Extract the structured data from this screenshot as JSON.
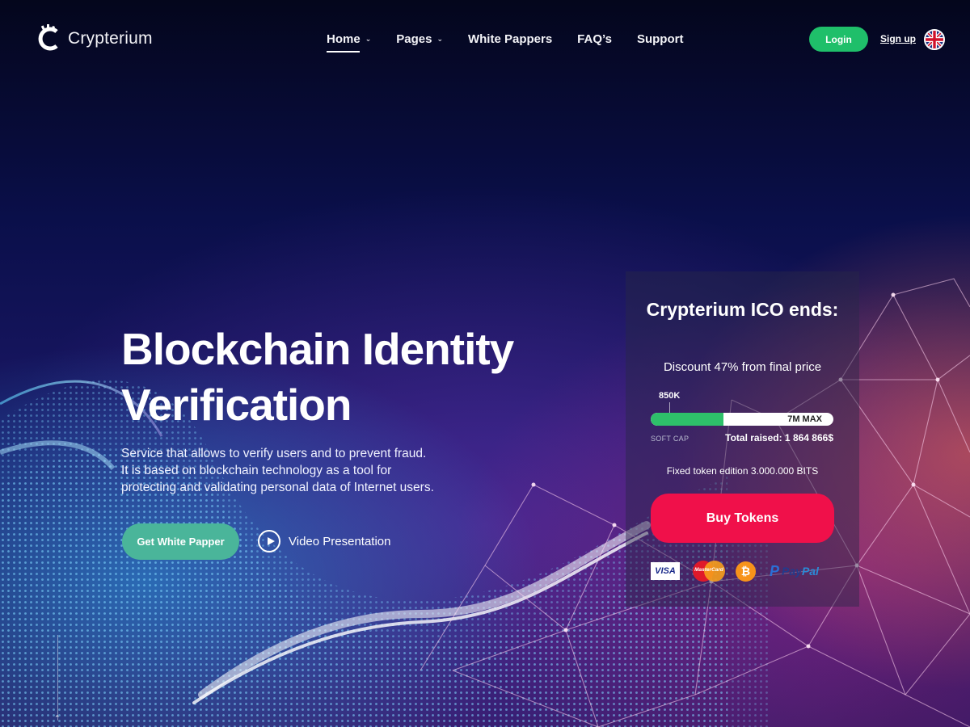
{
  "brand": {
    "name": "Crypterium",
    "logo_icon": "crypterium-logo-icon"
  },
  "nav": {
    "items": [
      {
        "label": "Home",
        "has_dropdown": true,
        "active": true
      },
      {
        "label": "Pages",
        "has_dropdown": true,
        "active": false
      },
      {
        "label": "White Pappers",
        "has_dropdown": false,
        "active": false
      },
      {
        "label": "FAQ’s",
        "has_dropdown": false,
        "active": false
      },
      {
        "label": "Support",
        "has_dropdown": false,
        "active": false
      }
    ],
    "caret_glyph": "⌄"
  },
  "auth": {
    "login_label": "Login",
    "signup_label": "Sign up",
    "language_icon": "uk-flag-icon"
  },
  "hero": {
    "title": "Blockchain Identity Verification",
    "description": "Service that allows to verify users and to prevent fraud. It is based on blockchain technology as a tool for protecting and validating personal data of Internet users.",
    "primary_button": "Get White Papper",
    "video_button": "Video Presentation"
  },
  "ico": {
    "title": "Crypterium ICO ends:",
    "discount": "Discount 47% from final price",
    "soft_cap_value": "850K",
    "max_label": "7M MAX",
    "soft_cap_label": "SOFT CAP",
    "total_raised": "Total raised: 1 864 866$",
    "progress_fraction": 0.4,
    "fixed_token": "Fixed token edition 3.000.000 BITS",
    "buy_button": "Buy Tokens",
    "payments": {
      "visa": "VISA",
      "mastercard": "MasterCard",
      "bitcoin": "₿",
      "paypal_p": "P",
      "paypal_pay": "Pay",
      "paypal_pal": "Pal"
    }
  },
  "colors": {
    "login": "#1fbf6a",
    "white_paper_button": "#4ab59a",
    "buy_button": "#f0104a",
    "progress_fill": "#2ec06a"
  },
  "side": {
    "mark": "⌃"
  }
}
